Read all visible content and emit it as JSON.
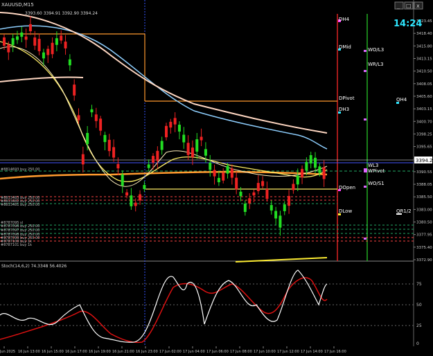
{
  "window": {
    "symbol_label": "XAUUSD,M15",
    "ohlc": "3393.60 3394.91 3392.90 3394.24",
    "clock": "14:24",
    "controls": [
      "_",
      "□",
      "x"
    ]
  },
  "colors": {
    "bull": "#22dd22",
    "bear": "#ee2222",
    "price_line": "#9fd0ff",
    "clock": "#2ee6ff",
    "stoch_main": "#ffffff",
    "stoch_signal": "#dd1111",
    "ema_orange": "#ff9a2e",
    "ema_yellow": "#ffee66",
    "ma_blue": "#8ecfff",
    "ma_pink": "#ffd7c2"
  },
  "price_axis": {
    "min": 3370.0,
    "max": 3425.0,
    "ticks": [
      "3423.45",
      "3418.40",
      "3415.80",
      "3413.15",
      "3410.50",
      "3408.05",
      "3405.60",
      "3403.15",
      "3400.70",
      "3398.25",
      "3395.65",
      "3393.10",
      "3390.55",
      "3388.05",
      "3385.50",
      "3383.00",
      "3380.50",
      "3377.95",
      "3375.40",
      "3372.90"
    ],
    "current_price": "3394.24"
  },
  "time_axis": {
    "labels": [
      "16 Jun 2025",
      "16 Jun 13:00",
      "16 Jun 15:00",
      "16 Jun 17:00",
      "16 Jun 19:00",
      "16 Jun 21:00",
      "16 Jun 23:00",
      "17 Jun 02:00",
      "17 Jun 04:00",
      "17 Jun 06:00",
      "17 Jun 08:00",
      "17 Jun 10:00",
      "17 Jun 12:00",
      "17 Jun 14:00",
      "17 Jun 16:00"
    ]
  },
  "levels": {
    "pivot_labels": [
      {
        "text": "DH4",
        "color": "#ffffff"
      },
      {
        "text": "DMid",
        "color": "#ffffff"
      },
      {
        "text": "DPivot",
        "color": "#ffffff"
      },
      {
        "text": "DH3",
        "color": "#ffffff"
      },
      {
        "text": "DOpen",
        "color": "#ffffff"
      },
      {
        "text": "DLow",
        "color": "#ffffff"
      },
      {
        "text": "WO/L3",
        "color": "#ffffff"
      },
      {
        "text": "WR/L3",
        "color": "#ffffff"
      },
      {
        "text": "WO/S1",
        "color": "#ffffff"
      },
      {
        "text": "QH4",
        "color": "#ffffff"
      },
      {
        "text": "QR1/2",
        "color": "#ffffff"
      },
      {
        "text": "WL3",
        "color": "#ffffff"
      },
      {
        "text": "WPivot",
        "color": "#ffffff"
      }
    ],
    "order_labels": [
      "#8814693 buy 250.00",
      "#8813483 buy 250.00",
      "#8813482 buy 250.00",
      "#8813481 buy 250.00",
      "#8787095 sl",
      "#8787096 buy 250.00",
      "#8787097 buy 250.00",
      "#8787098 buy 250.00",
      "#8787099 buy 250.00",
      "#8787100 buy 1k",
      "#8787101 buy 1k"
    ]
  },
  "stochastic": {
    "label": "Stoch(14,6,2) 74.3348 56.4026",
    "ticks": [
      "100",
      "75",
      "50",
      "25",
      "0"
    ],
    "main_value": 74.3348,
    "signal_value": 56.4026
  }
}
